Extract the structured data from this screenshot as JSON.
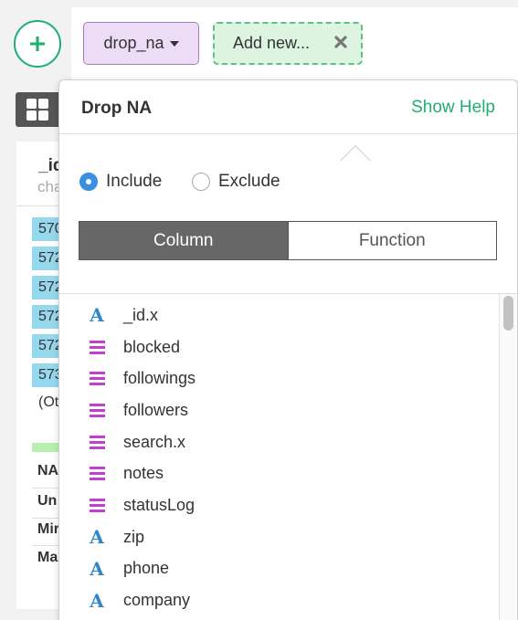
{
  "toolbar": {
    "add_icon": "plus-icon",
    "step_label": "drop_na",
    "new_step_label": "Add new...",
    "close_icon": "close-icon"
  },
  "background": {
    "view_toggle_icon": "grid-icon",
    "column_name": "_id",
    "column_type": "cha",
    "bar_values": [
      "570",
      "572",
      "572",
      "572",
      "572",
      "573"
    ],
    "other_label": "(Ot",
    "stats": [
      "NA",
      "Un",
      "Mir",
      "Ma"
    ],
    "edge_text": "t"
  },
  "popup": {
    "title": "Drop NA",
    "help_link": "Show Help",
    "radio_include": "Include",
    "radio_exclude": "Exclude",
    "selected_radio": "Include",
    "tab_column": "Column",
    "tab_function": "Function",
    "active_tab": "Column",
    "columns": [
      {
        "name": "_id.x",
        "type": "character"
      },
      {
        "name": "blocked",
        "type": "list"
      },
      {
        "name": "followings",
        "type": "list"
      },
      {
        "name": "followers",
        "type": "list"
      },
      {
        "name": "search.x",
        "type": "list"
      },
      {
        "name": "notes",
        "type": "list"
      },
      {
        "name": "statusLog",
        "type": "list"
      },
      {
        "name": "zip",
        "type": "character"
      },
      {
        "name": "phone",
        "type": "character"
      },
      {
        "name": "company",
        "type": "character"
      }
    ]
  },
  "colors": {
    "accent_green": "#1fae73",
    "radio_blue": "#3a8fe0",
    "char_icon": "#2f86c9",
    "list_icon": "#c43fd1"
  }
}
